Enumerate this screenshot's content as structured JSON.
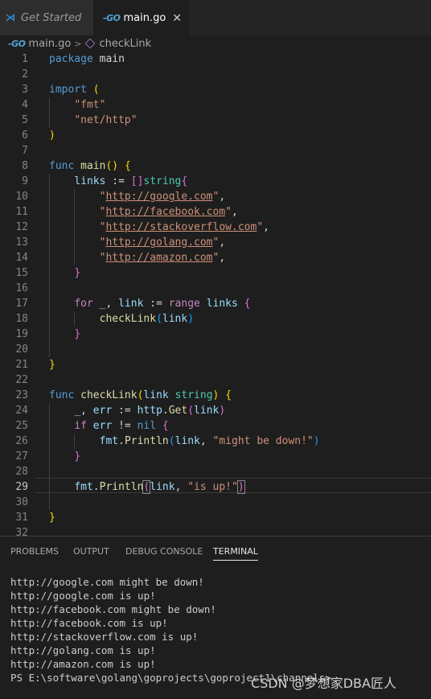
{
  "tabs": [
    {
      "label": "Get Started",
      "icon": "vscode-icon"
    },
    {
      "label": "main.go",
      "icon": "go-file-icon",
      "active": true
    }
  ],
  "breadcrumb": {
    "file": "main.go",
    "symbol": "checkLink"
  },
  "editor": {
    "active_line": 29,
    "line_numbers": [
      "1",
      "2",
      "3",
      "4",
      "5",
      "6",
      "7",
      "8",
      "9",
      "10",
      "11",
      "12",
      "13",
      "14",
      "15",
      "16",
      "17",
      "18",
      "19",
      "20",
      "21",
      "22",
      "23",
      "24",
      "25",
      "26",
      "27",
      "28",
      "29",
      "30",
      "31",
      "32"
    ]
  },
  "panel": {
    "tabs": [
      "PROBLEMS",
      "OUTPUT",
      "DEBUG CONSOLE",
      "TERMINAL"
    ],
    "active_tab": "TERMINAL",
    "terminal_lines": [
      "http://google.com might be down!",
      "http://google.com is up!",
      "http://facebook.com might be down!",
      "http://facebook.com is up!",
      "http://stackoverflow.com is up!",
      "http://golang.com is up!",
      "http://amazon.com is up!",
      "PS E:\\software\\golang\\goprojects\\goproject1\\channels>"
    ]
  },
  "watermark": "CSDN @梦想家DBA匠人",
  "colors": {
    "keyword": "#569cd6",
    "control": "#c586c0",
    "function": "#dcdcaa",
    "string": "#ce9178",
    "variable": "#9cdcfe",
    "type": "#4ec9b0"
  }
}
